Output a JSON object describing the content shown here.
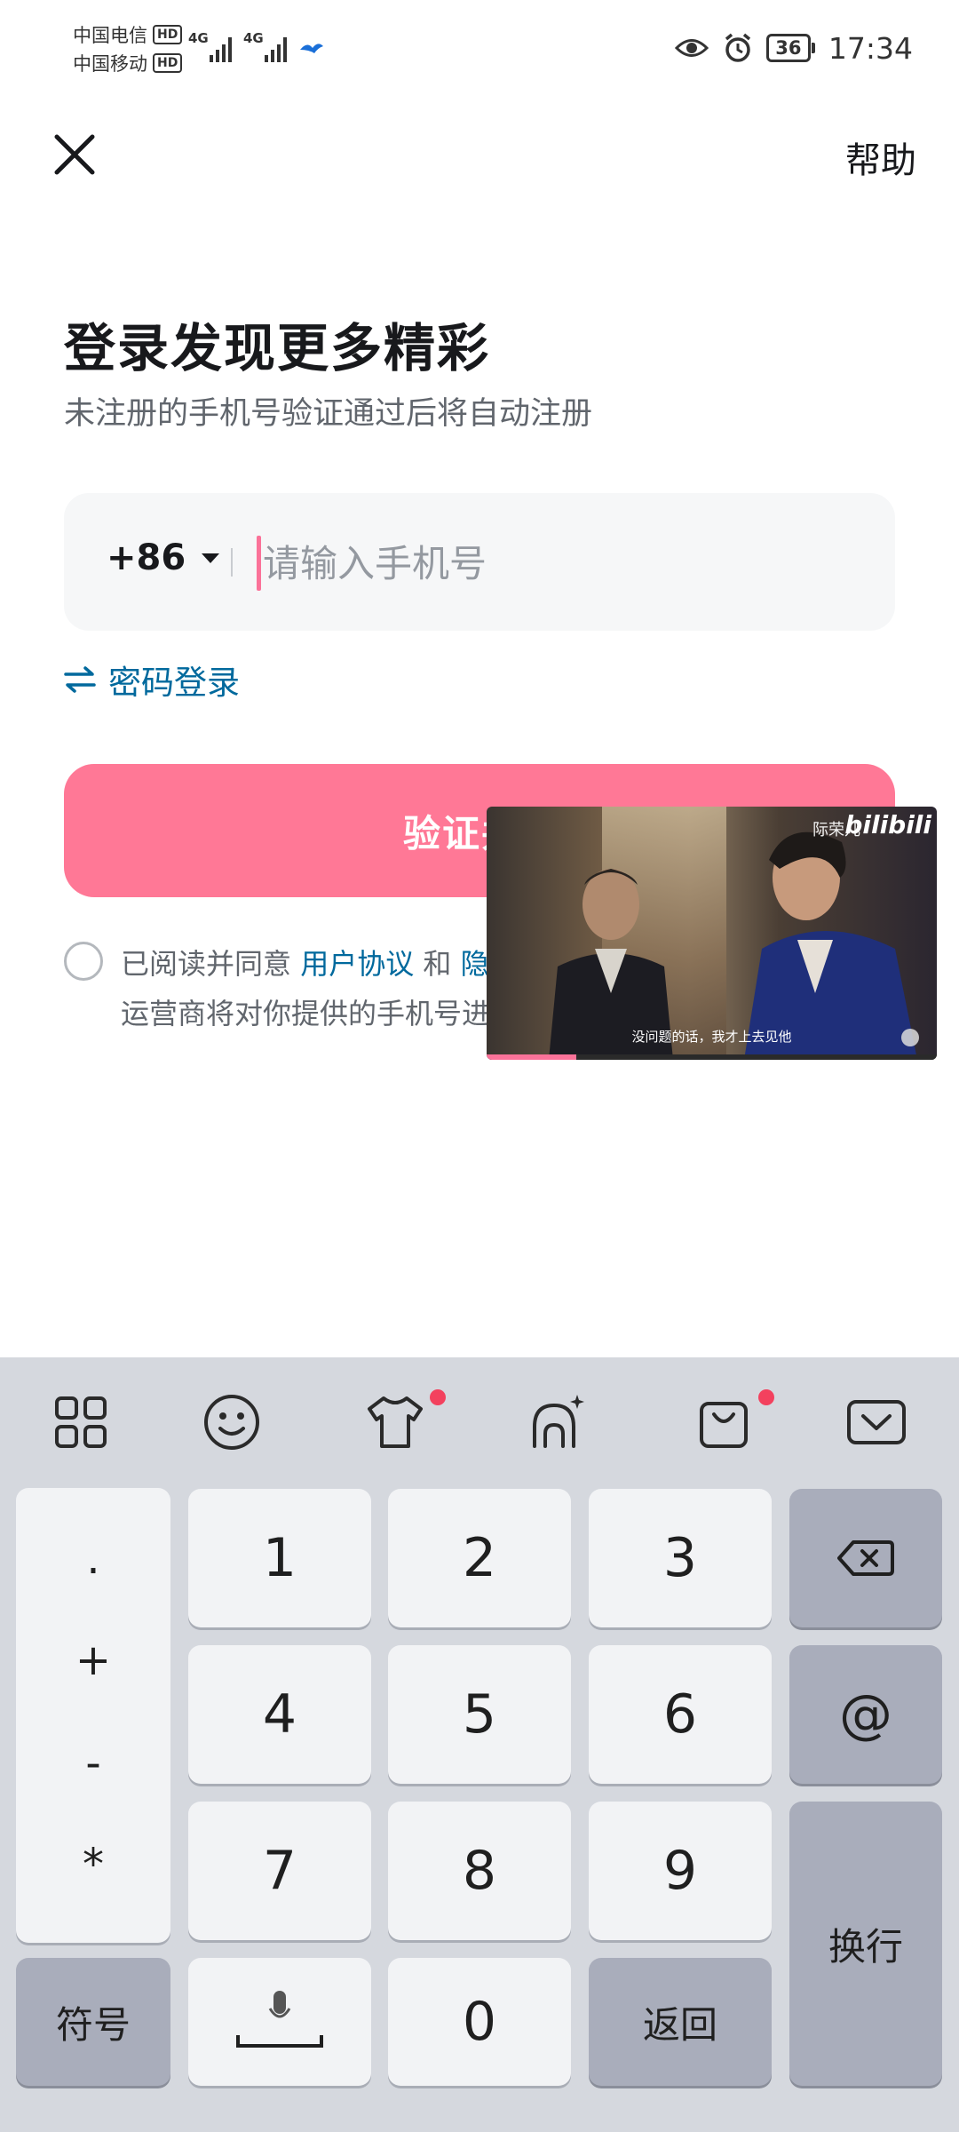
{
  "status_bar": {
    "carrier1": "中国电信",
    "carrier2": "中国移动",
    "hd": "HD",
    "net1": "4G",
    "net2": "4G",
    "battery": "36",
    "time": "17:34"
  },
  "header": {
    "help": "帮助"
  },
  "login": {
    "title": "登录发现更多精彩",
    "subtitle": "未注册的手机号验证通过后将自动注册",
    "country_code": "+86",
    "phone_placeholder": "请输入手机号",
    "phone_value": "",
    "password_login": "密码登录",
    "verify_button": "验证并",
    "agreement_prefix": "已阅读并同意",
    "user_agreement": "用户协议",
    "and": "和",
    "privacy_partial": "隐",
    "agreement_line2": "运营商将对你提供的手机号进"
  },
  "video": {
    "logo": "bilibili",
    "tag": "际荣儿",
    "subtitle": "没问题的话，我才上去见他",
    "progress": 0.2
  },
  "keyboard": {
    "toolbar": [
      "grid-icon",
      "emoji-icon",
      "tshirt-icon",
      "palette-icon",
      "shopping-bag-icon",
      "keyboard-hide-icon"
    ],
    "symbols": [
      ".",
      "+",
      "-",
      "*"
    ],
    "digits": [
      "1",
      "2",
      "3",
      "4",
      "5",
      "6",
      "7",
      "8",
      "9",
      "0"
    ],
    "at": "@",
    "enter": "换行",
    "symbol_key": "符号",
    "return_key": "返回"
  },
  "colors": {
    "brand_pink": "#fb7299",
    "link_blue": "#00699d"
  }
}
